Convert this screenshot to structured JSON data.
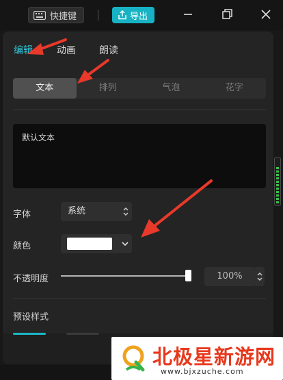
{
  "toolbar": {
    "shortcut_label": "快捷键",
    "export_label": "导出"
  },
  "panel": {
    "tabs": [
      {
        "label": "编辑",
        "active": true
      },
      {
        "label": "动画",
        "active": false
      },
      {
        "label": "朗读",
        "active": false
      }
    ],
    "subtabs": [
      {
        "label": "文本",
        "active": true
      },
      {
        "label": "排列",
        "active": false
      },
      {
        "label": "气泡",
        "active": false
      },
      {
        "label": "花字",
        "active": false
      }
    ],
    "text_value": "默认文本",
    "font": {
      "label": "字体",
      "value": "系统"
    },
    "color": {
      "label": "颜色",
      "value": "#ffffff"
    },
    "opacity": {
      "label": "不透明度",
      "value": "100%",
      "fraction": 1.0
    },
    "preset_label": "预设样式"
  },
  "watermark": {
    "title": "北极星新游网",
    "url": "www.bjxzuche.com"
  },
  "colors": {
    "accent": "#17b3c4",
    "annotation_arrow": "#e8392b"
  },
  "icons": [
    "keyboard-icon",
    "upload-icon",
    "minimize-icon",
    "maximize-icon",
    "close-icon",
    "chevron-updown-icon",
    "chevron-down-icon",
    "watermark-logo-icon"
  ]
}
